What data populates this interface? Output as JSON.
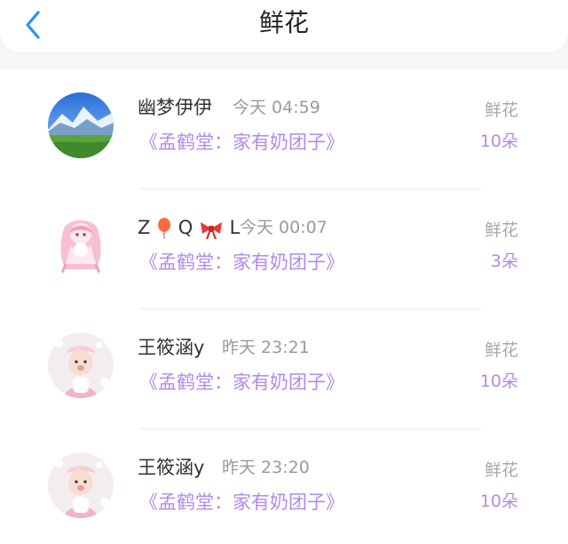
{
  "header": {
    "title": "鲜花",
    "back_icon": "chevron-left-icon"
  },
  "colors": {
    "accent": "#b28be6",
    "back": "#2196f3",
    "muted": "#9a9a9a"
  },
  "records": [
    {
      "name": "幽梦伊伊",
      "time": "今天 04:59",
      "work": "《孟鹤堂：家有奶团子》",
      "gift": "鲜花",
      "count": "10朵",
      "avatar_icon": "mountain-avatar-icon"
    },
    {
      "name_parts": [
        "Z",
        "Q",
        "L"
      ],
      "time": "今天 00:07",
      "work": "《孟鹤堂：家有奶团子》",
      "gift": "鲜花",
      "count": "3朵",
      "avatar_icon": "anime-girl-avatar-icon",
      "name_icons": [
        "balloon-icon",
        "bow-icon"
      ]
    },
    {
      "name": "王筱涵y",
      "time": "昨天 23:21",
      "work": "《孟鹤堂：家有奶团子》",
      "gift": "鲜花",
      "count": "10朵",
      "avatar_icon": "child-avatar-icon"
    },
    {
      "name": "王筱涵y",
      "time": "昨天 23:20",
      "work": "《孟鹤堂：家有奶团子》",
      "gift": "鲜花",
      "count": "10朵",
      "avatar_icon": "child-avatar-icon"
    }
  ]
}
